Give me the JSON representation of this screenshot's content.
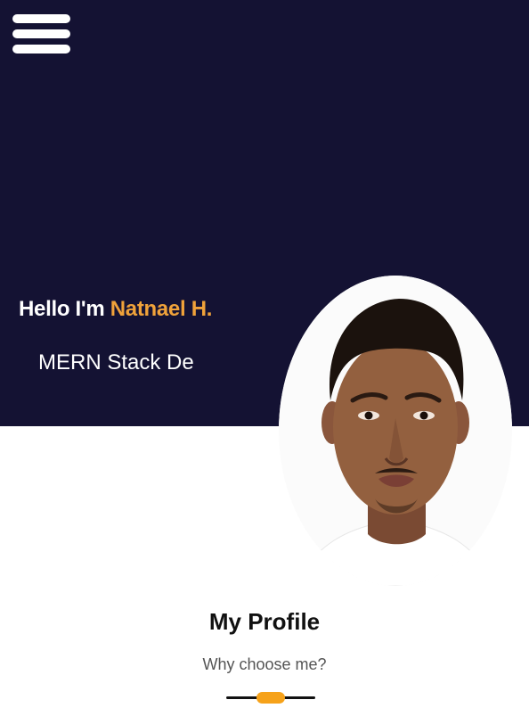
{
  "menu": {
    "icon": "hamburger-menu-icon"
  },
  "hero": {
    "greeting_prefix": "Hello I'm ",
    "greeting_name": "Natnael H.",
    "role_text": "MERN Stack De",
    "name_color": "#f0a23a",
    "background_color": "#141233"
  },
  "profile": {
    "title": "My Profile",
    "subtitle": "Why choose me?",
    "accent_color": "#f6a21a"
  }
}
